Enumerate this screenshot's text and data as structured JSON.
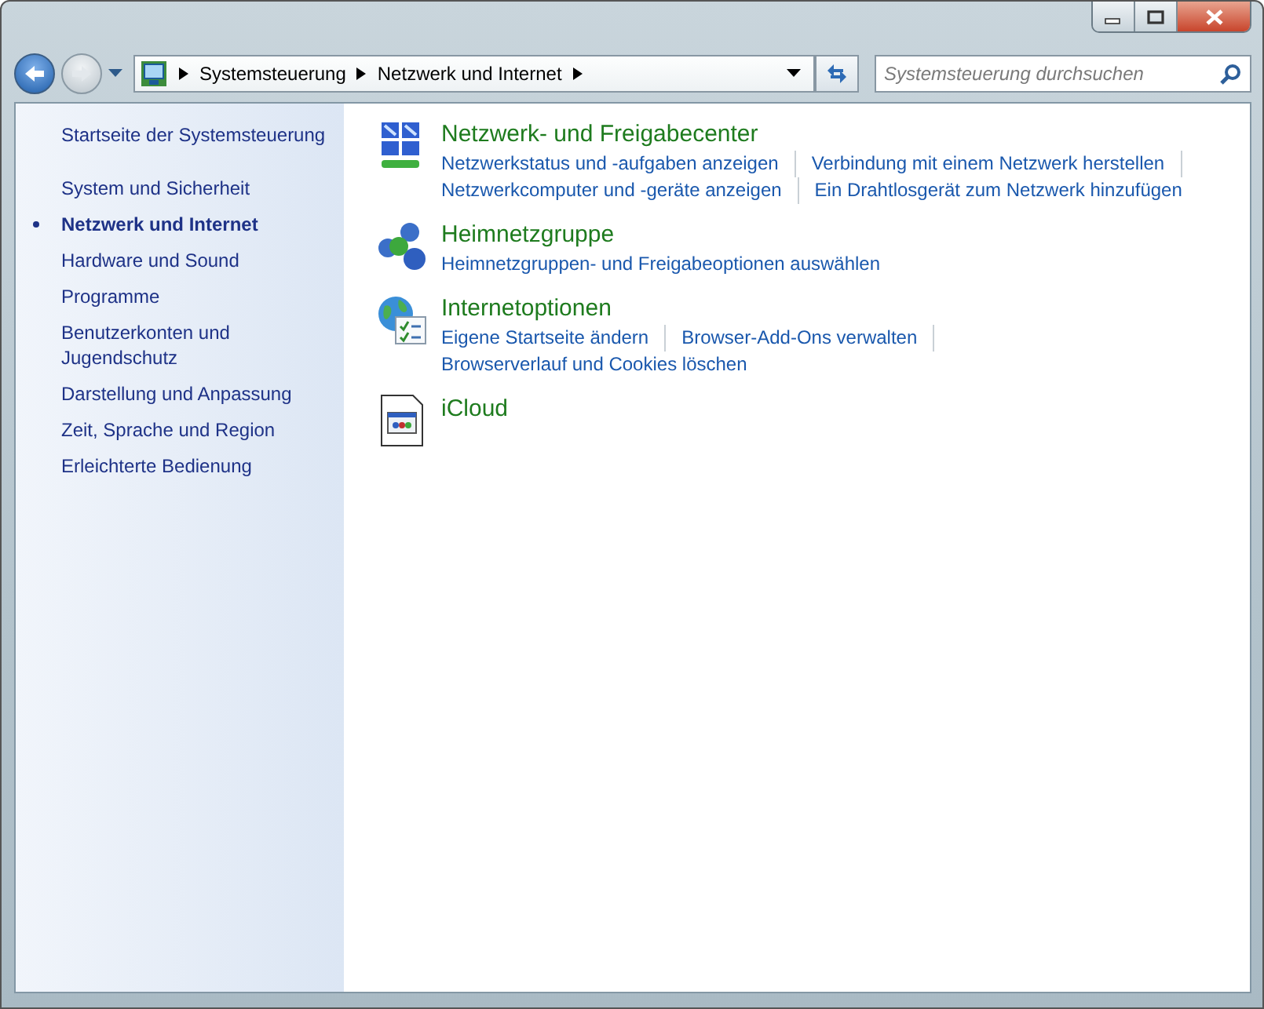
{
  "window": {
    "caption_buttons": [
      {
        "kind": "minimize"
      },
      {
        "kind": "maximize"
      },
      {
        "kind": "close"
      }
    ]
  },
  "address_bar": {
    "crumbs": [
      "Systemsteuerung",
      "Netzwerk und Internet"
    ]
  },
  "search": {
    "placeholder": "Systemsteuerung durchsuchen"
  },
  "sidebar": {
    "home": "Startseite der Systemsteuerung",
    "items": [
      {
        "label": "System und Sicherheit",
        "selected": false
      },
      {
        "label": "Netzwerk und Internet",
        "selected": true
      },
      {
        "label": "Hardware und Sound",
        "selected": false
      },
      {
        "label": "Programme",
        "selected": false
      },
      {
        "label": "Benutzerkonten und Jugendschutz",
        "selected": false
      },
      {
        "label": "Darstellung und Anpassung",
        "selected": false
      },
      {
        "label": "Zeit, Sprache und Region",
        "selected": false
      },
      {
        "label": "Erleichterte Bedienung",
        "selected": false
      }
    ]
  },
  "categories": [
    {
      "kind": "network",
      "title": "Netzwerk- und Freigabecenter",
      "link_rows": [
        [
          "Netzwerkstatus und -aufgaben anzeigen",
          "Verbindung mit einem Netzwerk herstellen"
        ],
        [
          "Netzwerkcomputer und -geräte anzeigen",
          "Ein Drahtlosgerät zum Netzwerk hinzufügen"
        ]
      ]
    },
    {
      "kind": "homegroup",
      "title": "Heimnetzgruppe",
      "link_rows": [
        [
          "Heimnetzgruppen- und Freigabeoptionen auswählen"
        ]
      ]
    },
    {
      "kind": "internet",
      "title": "Internetoptionen",
      "link_rows": [
        [
          "Eigene Startseite ändern",
          "Browser-Add-Ons verwalten"
        ],
        [
          "Browserverlauf und Cookies löschen"
        ]
      ]
    },
    {
      "kind": "app",
      "title": "iCloud"
    }
  ]
}
